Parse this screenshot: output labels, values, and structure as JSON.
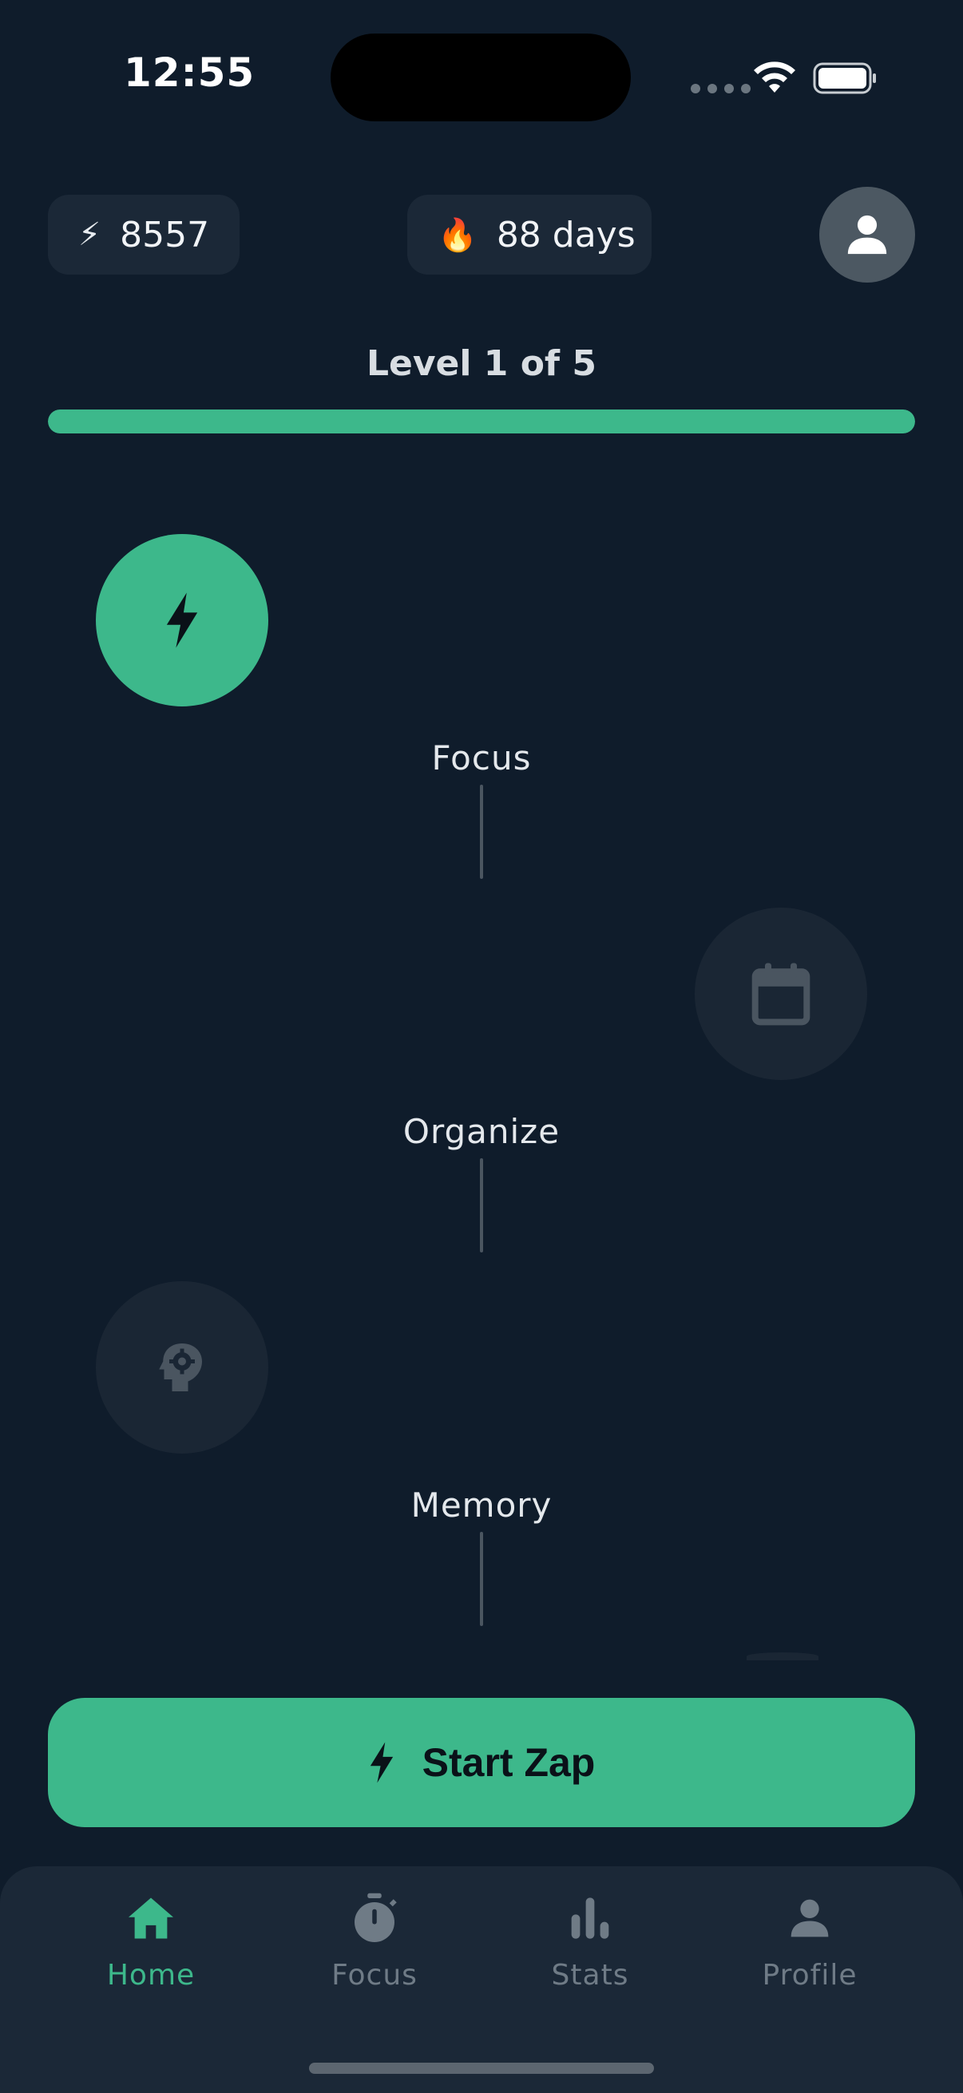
{
  "status_bar": {
    "time": "12:55"
  },
  "header": {
    "points": {
      "emoji": "⚡",
      "value": "8557"
    },
    "streak": {
      "emoji": "🔥",
      "value": "88 days"
    },
    "avatar_icon": "person-icon"
  },
  "level": {
    "title": "Level 1 of 5",
    "progress_percent": 100
  },
  "path": {
    "nodes": [
      {
        "label": "Focus",
        "icon": "bolt-icon",
        "state": "active"
      },
      {
        "label": "Organize",
        "icon": "calendar-icon",
        "state": "locked"
      },
      {
        "label": "Memory",
        "icon": "brain-gear-icon",
        "state": "locked"
      }
    ]
  },
  "cta": {
    "label": "Start Zap",
    "icon": "bolt-icon"
  },
  "tabs": [
    {
      "label": "Home",
      "icon": "home-icon",
      "active": true
    },
    {
      "label": "Focus",
      "icon": "stopwatch-icon",
      "active": false
    },
    {
      "label": "Stats",
      "icon": "bar-chart-icon",
      "active": false
    },
    {
      "label": "Profile",
      "icon": "person-icon",
      "active": false
    }
  ],
  "colors": {
    "background": "#0f1c2b",
    "accent": "#3db88b",
    "surface": "#1b2837",
    "muted": "#6f7b86"
  }
}
